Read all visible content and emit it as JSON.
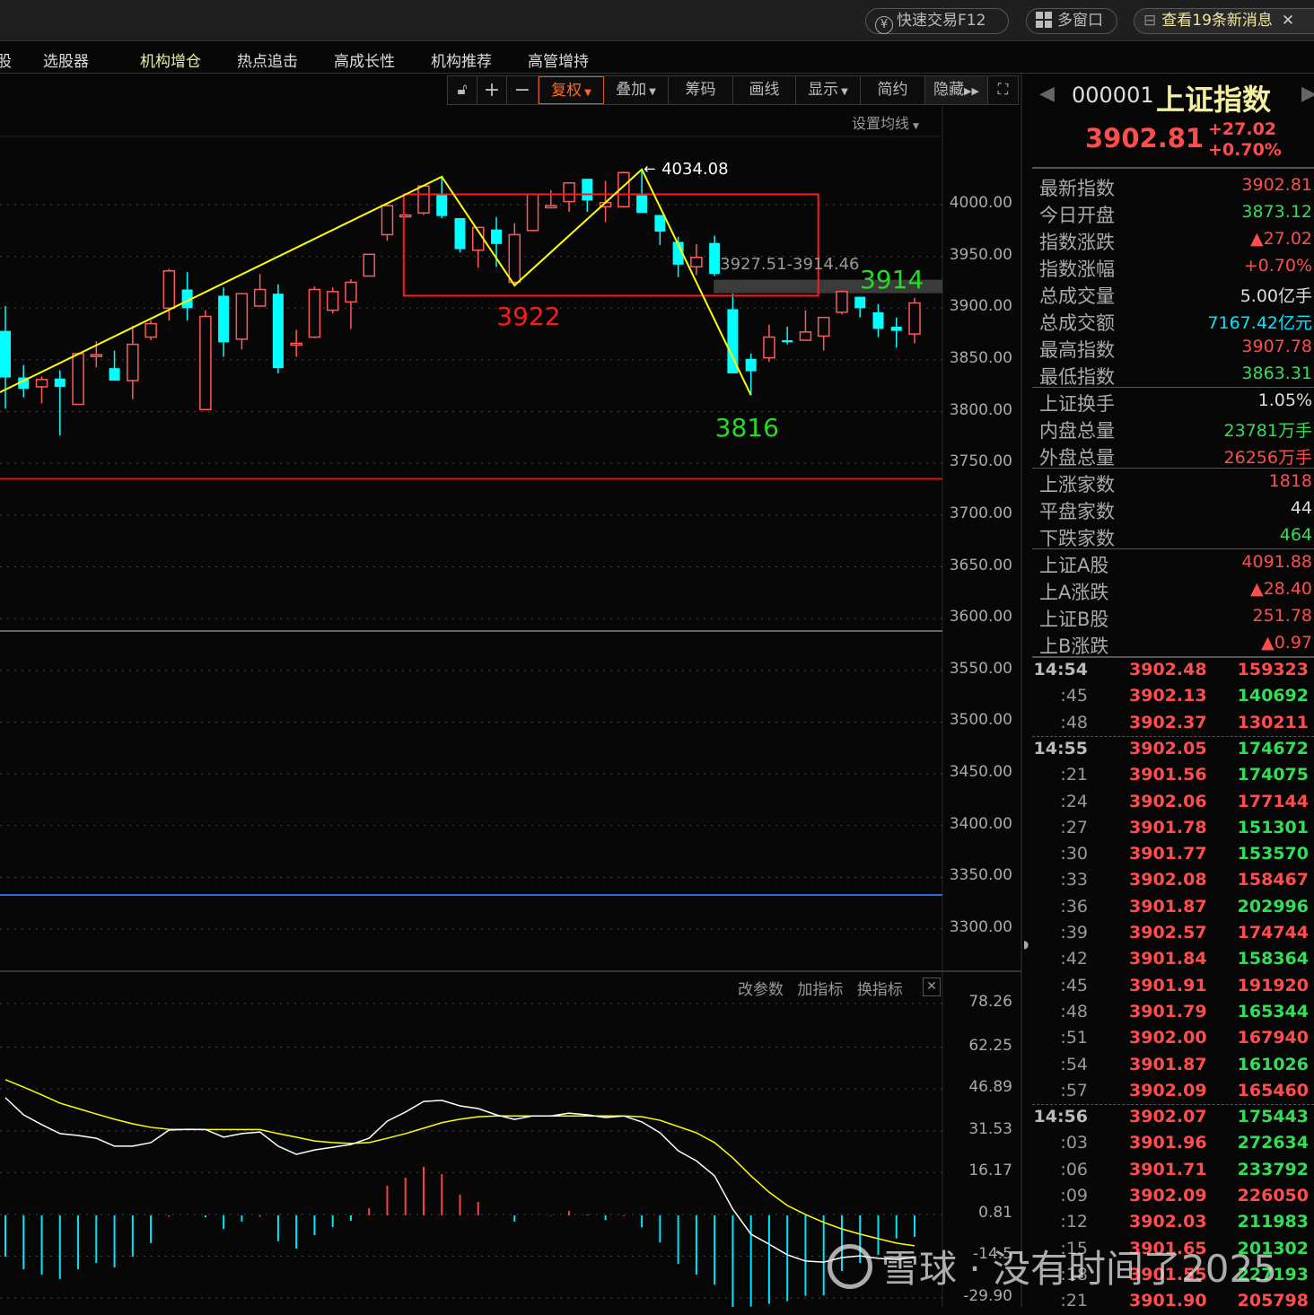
{
  "topbar": {
    "quick_trade": "快速交易F12",
    "multi_window": "多窗口",
    "messages": "查看19条新消息"
  },
  "nav": {
    "items": [
      "股",
      "选股器",
      "机构增仓",
      "热点追击",
      "高成长性",
      "机构推荐",
      "高管增持"
    ]
  },
  "toolbar": {
    "plus": "+",
    "minus": "−",
    "fuquan": "复权",
    "overlay": "叠加",
    "chips": "筹码",
    "draw": "画线",
    "display": "显示",
    "simple": "简约",
    "hide": "隐藏"
  },
  "chart": {
    "ma_setting": "设置均线"
  },
  "indicator": {
    "change_params": "改参数",
    "add_indicator": "加指标",
    "switch_indicator": "换指标"
  },
  "quote": {
    "code": "000001",
    "name": "上证指数",
    "price": "3902.81",
    "change": "+27.02",
    "change_pct": "+0.70%"
  },
  "info": [
    {
      "label": "最新指数",
      "value": "3902.81",
      "color": "red"
    },
    {
      "label": "今日开盘",
      "value": "3873.12",
      "color": "green"
    },
    {
      "label": "指数涨跌",
      "value": "▲27.02",
      "color": "red"
    },
    {
      "label": "指数涨幅",
      "value": "+0.70%",
      "color": "red"
    },
    {
      "label": "总成交量",
      "value": "5.00亿手",
      "color": "white"
    },
    {
      "label": "总成交额",
      "value": "7167.42亿元",
      "color": "cyan"
    },
    {
      "label": "最高指数",
      "value": "3907.78",
      "color": "red"
    },
    {
      "label": "最低指数",
      "value": "3863.31",
      "color": "green"
    },
    {
      "label": "上证换手",
      "value": "1.05%",
      "color": "white"
    },
    {
      "label": "内盘总量",
      "value": "23781万手",
      "color": "green"
    },
    {
      "label": "外盘总量",
      "value": "26256万手",
      "color": "red"
    },
    {
      "label": "上涨家数",
      "value": "1818",
      "color": "red"
    },
    {
      "label": "平盘家数",
      "value": "44",
      "color": "white"
    },
    {
      "label": "下跌家数",
      "value": "464",
      "color": "green"
    },
    {
      "label": "上证A股",
      "value": "4091.88",
      "color": "red"
    },
    {
      "label": "上A涨跌",
      "value": "▲28.40",
      "color": "red"
    },
    {
      "label": "上证B股",
      "value": "251.78",
      "color": "red"
    },
    {
      "label": "上B涨跌",
      "value": "▲0.97",
      "color": "red"
    }
  ],
  "ticks": [
    {
      "time": "14:54",
      "price": "3902.48",
      "vol": "159323",
      "vc": "red"
    },
    {
      "time": ":45",
      "price": "3902.13",
      "vol": "140692",
      "vc": "green"
    },
    {
      "time": ":48",
      "price": "3902.37",
      "vol": "130211",
      "vc": "red"
    },
    {
      "time": "14:55",
      "price": "3902.05",
      "vol": "174672",
      "vc": "green"
    },
    {
      "time": ":21",
      "price": "3901.56",
      "vol": "174075",
      "vc": "green"
    },
    {
      "time": ":24",
      "price": "3902.06",
      "vol": "177144",
      "vc": "red"
    },
    {
      "time": ":27",
      "price": "3901.78",
      "vol": "151301",
      "vc": "green"
    },
    {
      "time": ":30",
      "price": "3901.77",
      "vol": "153570",
      "vc": "green"
    },
    {
      "time": ":33",
      "price": "3902.08",
      "vol": "158467",
      "vc": "red"
    },
    {
      "time": ":36",
      "price": "3901.87",
      "vol": "202996",
      "vc": "green"
    },
    {
      "time": ":39",
      "price": "3902.57",
      "vol": "174744",
      "vc": "red"
    },
    {
      "time": ":42",
      "price": "3901.84",
      "vol": "158364",
      "vc": "green"
    },
    {
      "time": ":45",
      "price": "3901.91",
      "vol": "191920",
      "vc": "red"
    },
    {
      "time": ":48",
      "price": "3901.79",
      "vol": "165344",
      "vc": "green"
    },
    {
      "time": ":51",
      "price": "3902.00",
      "vol": "167940",
      "vc": "red"
    },
    {
      "time": ":54",
      "price": "3901.87",
      "vol": "161026",
      "vc": "green"
    },
    {
      "time": ":57",
      "price": "3902.09",
      "vol": "165460",
      "vc": "red"
    },
    {
      "time": "14:56",
      "price": "3902.07",
      "vol": "175443",
      "vc": "green"
    },
    {
      "time": ":03",
      "price": "3901.96",
      "vol": "272634",
      "vc": "green"
    },
    {
      "time": ":06",
      "price": "3901.71",
      "vol": "233792",
      "vc": "green"
    },
    {
      "time": ":09",
      "price": "3902.09",
      "vol": "226050",
      "vc": "red"
    },
    {
      "time": ":12",
      "price": "3902.03",
      "vol": "211983",
      "vc": "green"
    },
    {
      "time": ":15",
      "price": "3901.65",
      "vol": "201302",
      "vc": "green"
    },
    {
      "time": ":18",
      "price": "3901.55",
      "vol": "227193",
      "vc": "green"
    },
    {
      "time": ":21",
      "price": "3901.90",
      "vol": "205798",
      "vc": "red"
    }
  ],
  "watermark": "雪球 · 没有时间了2025",
  "colors": {
    "up": "#ff5a5a",
    "down": "#00ffff",
    "zigzag": "#ffff00",
    "box": "#ff1a1a"
  },
  "chart_data": [
    {
      "type": "candlestick",
      "title": "上证指数",
      "y_ticks": [
        "4000.00",
        "3950.00",
        "3900.00",
        "3850.00",
        "3800.00",
        "3750.00",
        "3700.00",
        "3650.00",
        "3600.00",
        "3550.00",
        "3500.00",
        "3450.00",
        "3400.00",
        "3350.00",
        "3300.00"
      ],
      "ylim": [
        3300,
        4000
      ],
      "ohlc": [
        [
          3878,
          3902,
          3803,
          3833
        ],
        [
          3833,
          3845,
          3814,
          3822
        ],
        [
          3824,
          3834,
          3808,
          3831
        ],
        [
          3832,
          3840,
          3777,
          3824
        ],
        [
          3807,
          3857,
          3807,
          3856
        ],
        [
          3854,
          3868,
          3843,
          3855
        ],
        [
          3842,
          3859,
          3830,
          3830
        ],
        [
          3830,
          3883,
          3812,
          3865
        ],
        [
          3872,
          3888,
          3869,
          3885
        ],
        [
          3900,
          3938,
          3888,
          3936
        ],
        [
          3918,
          3935,
          3888,
          3900
        ],
        [
          3802,
          3898,
          3802,
          3892
        ],
        [
          3912,
          3920,
          3853,
          3867
        ],
        [
          3870,
          3914,
          3860,
          3914
        ],
        [
          3902,
          3933,
          3902,
          3918
        ],
        [
          3914,
          3923,
          3837,
          3842
        ],
        [
          3866,
          3879,
          3853,
          3866
        ],
        [
          3872,
          3921,
          3871,
          3918
        ],
        [
          3898,
          3920,
          3895,
          3916
        ],
        [
          3906,
          3928,
          3880,
          3925
        ],
        [
          3931,
          3952,
          3931,
          3952
        ],
        [
          3971,
          4001,
          3965,
          3999
        ],
        [
          3989,
          3991,
          3989,
          3990
        ],
        [
          3992,
          4018,
          3990,
          4018
        ],
        [
          4010,
          4027,
          3987,
          3989
        ],
        [
          3987,
          3987,
          3954,
          3957
        ],
        [
          3956,
          3978,
          3939,
          3978
        ],
        [
          3976,
          3988,
          3940,
          3962
        ],
        [
          3925,
          3982,
          3922,
          3971
        ],
        [
          3975,
          4011,
          3975,
          4010
        ],
        [
          3997,
          4014,
          3997,
          3999
        ],
        [
          4003,
          4021,
          3993,
          4021
        ],
        [
          4025,
          4025,
          3993,
          4004
        ],
        [
          3998,
          4023,
          3983,
          4002
        ],
        [
          3998,
          4032,
          3998,
          4031
        ],
        [
          4009,
          4034.08,
          4009,
          3992
        ],
        [
          3990,
          3990,
          3961,
          3974
        ],
        [
          3964,
          3969,
          3930,
          3942
        ],
        [
          3940,
          3962,
          3932,
          3949
        ],
        [
          3963,
          3970,
          3931,
          3933
        ],
        [
          3899,
          3914,
          3837,
          3837
        ],
        [
          3851,
          3856,
          3816,
          3839
        ],
        [
          3852,
          3884,
          3848,
          3872
        ],
        [
          3869,
          3882,
          3865,
          3867
        ],
        [
          3869,
          3898,
          3869,
          3877
        ],
        [
          3873,
          3891,
          3859,
          3891
        ],
        [
          3896,
          3917,
          3894,
          3916
        ],
        [
          3911,
          3911,
          3891,
          3900
        ],
        [
          3896,
          3904,
          3872,
          3880
        ],
        [
          3882,
          3891,
          3862,
          3878
        ],
        [
          3875,
          3910,
          3866,
          3905
        ]
      ],
      "zigzag": [
        [
          -0.3,
          3818.7
        ],
        [
          24,
          4027
        ],
        [
          28,
          3922
        ],
        [
          35,
          4034.08
        ],
        [
          41,
          3816
        ]
      ],
      "box": {
        "index_range": [
          22.2,
          45
        ],
        "price_range": [
          3912,
          4010
        ]
      },
      "band": {
        "label": "3927.51-3914.46",
        "price_range": [
          3914.46,
          3927.51
        ],
        "from_index": 39
      },
      "hlines": [
        {
          "price": 3735,
          "color": "#e01010"
        },
        {
          "price": 3588,
          "color": "#666666"
        },
        {
          "price": 3333,
          "color": "#2a6be0"
        }
      ],
      "labels": [
        {
          "text": "4034.08",
          "index": 35,
          "price": 4034.08,
          "color": "#ffffff"
        },
        {
          "text": "3922",
          "index": 28,
          "price": 3922,
          "color": "#ff1a1a"
        },
        {
          "text": "3914",
          "index": 46,
          "price": 3914,
          "color": "#22dd22"
        },
        {
          "text": "3816",
          "index": 41,
          "price": 3816,
          "color": "#22dd22"
        }
      ]
    },
    {
      "type": "macd",
      "y_ticks": [
        "78.26",
        "62.25",
        "46.89",
        "31.53",
        "16.17",
        "0.81",
        "-14.5",
        "-29.90"
      ],
      "ylim": [
        -31,
        79
      ],
      "dif": [
        43.7,
        37.4,
        33.8,
        30.5,
        29.8,
        28.8,
        25.9,
        25.9,
        27.2,
        31.8,
        32.1,
        32,
        29.2,
        30.5,
        31.1,
        25.9,
        22.9,
        24.5,
        25.5,
        26.5,
        28.8,
        35.1,
        38.4,
        42.3,
        42.7,
        40.7,
        39.7,
        37.4,
        35.7,
        37,
        37,
        38,
        37.4,
        36.4,
        37,
        34.8,
        30.8,
        24.2,
        20.5,
        15,
        2.8,
        -6.4,
        -10.1,
        -14,
        -16.3,
        -16.7,
        -15,
        -14.4,
        -15.3,
        -15.7,
        -15
      ],
      "dea": [
        50.3,
        47.6,
        44.7,
        41.7,
        39.7,
        37.7,
        35.8,
        34.1,
        32.8,
        32.1,
        32,
        32,
        32,
        32,
        32,
        30.5,
        29.2,
        27.8,
        27.2,
        26.9,
        27.2,
        28.8,
        30.5,
        32.5,
        34.5,
        35.8,
        36.7,
        37,
        37,
        37,
        37,
        37,
        37,
        37,
        37,
        36.7,
        35.4,
        33.1,
        30.8,
        27.2,
        21.6,
        15,
        9,
        4.1,
        0.8,
        -2.1,
        -4.5,
        -6.4,
        -8.1,
        -9.7,
        -10.7
      ],
      "hist": [
        -14.7,
        -19.3,
        -21.3,
        -22.9,
        -19.3,
        -17,
        -18.6,
        -14.7,
        -9.7,
        0,
        0.5,
        -0.3,
        -4.5,
        -1.8,
        0,
        -9,
        -11.7,
        -6.8,
        -3.8,
        -1.5,
        3.1,
        11.4,
        14.3,
        18.3,
        15.6,
        8.1,
        5.4,
        0.5,
        -1.8,
        0.5,
        0.3,
        2.1,
        0.8,
        -1.2,
        0.2,
        -3.9,
        -9.5,
        -17.4,
        -21.3,
        -25,
        -35,
        -33,
        -32,
        -31,
        -29,
        -28.9,
        -20,
        -17,
        -14,
        -8,
        -7.4
      ]
    }
  ]
}
